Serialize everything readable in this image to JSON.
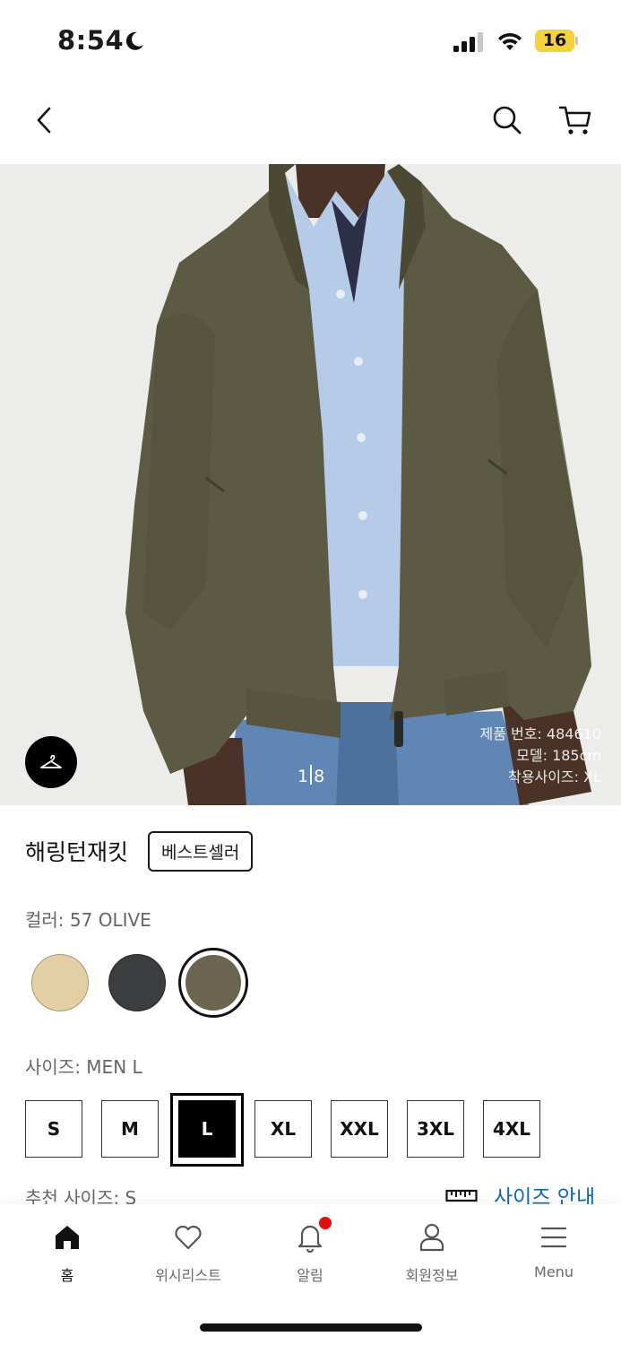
{
  "status_bar": {
    "time": "8:54",
    "battery": "16"
  },
  "product": {
    "title": "해링턴재킷",
    "badge": "베스트셀러",
    "image": {
      "page_current": "1",
      "page_total": "8"
    },
    "model_info": [
      "제품 번호: 484610",
      "모델: 185cm",
      "착용사이즈: XL"
    ],
    "color_label": "컬러: 57 OLIVE",
    "colors": [
      {
        "name": "beige",
        "hex": "#e3cfa3"
      },
      {
        "name": "dark gray",
        "hex": "#3c3d3f"
      },
      {
        "name": "57 OLIVE",
        "hex": "#6b6550",
        "selected": true
      }
    ],
    "size_label": "사이즈: MEN L",
    "sizes": [
      "S",
      "M",
      "L",
      "XL",
      "XXL",
      "3XL",
      "4XL"
    ],
    "selected_size": "L",
    "recommended_size": "추천 사이즈: S",
    "size_guide": "사이즈 안내"
  },
  "nav": {
    "items": [
      {
        "label": "홈",
        "icon": "home-icon",
        "active": true
      },
      {
        "label": "위시리스트",
        "icon": "heart-icon"
      },
      {
        "label": "알림",
        "icon": "bell-icon"
      },
      {
        "label": "회원정보",
        "icon": "user-icon"
      },
      {
        "label": "Menu",
        "icon": "menu-icon"
      }
    ]
  },
  "colors": {
    "accent_link": "#1266b6",
    "notification": "#e01010",
    "battery": "#f4d33a"
  }
}
